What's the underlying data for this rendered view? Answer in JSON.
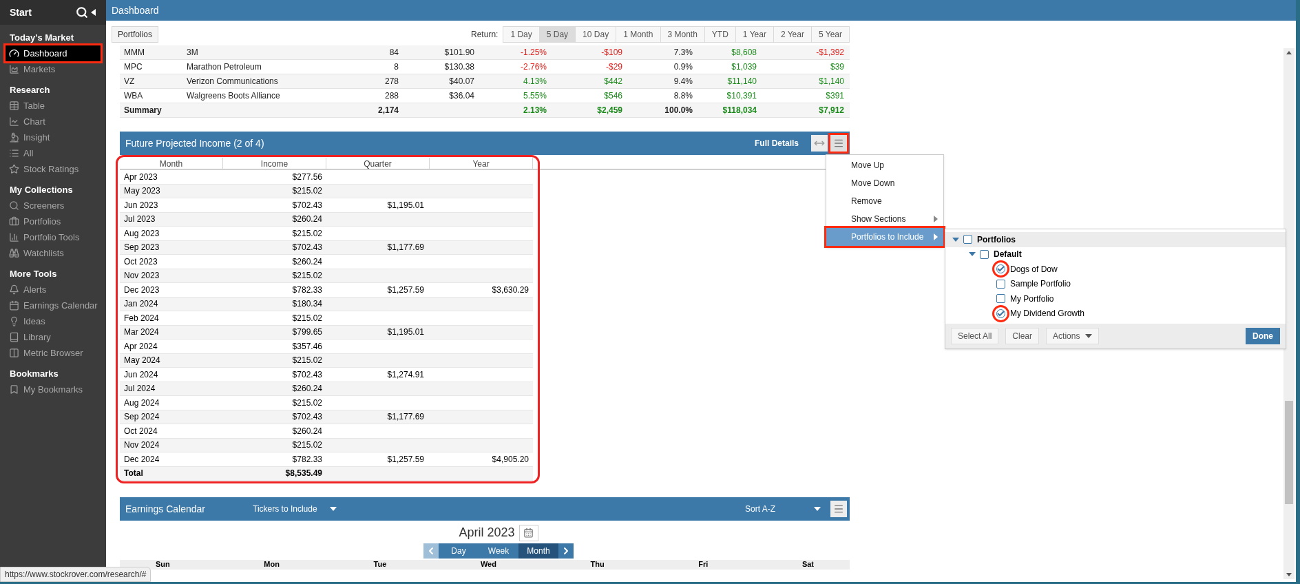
{
  "sidebar": {
    "title": "Start",
    "sections": [
      {
        "heading": "Today's Market",
        "items": [
          {
            "label": "Dashboard",
            "selected": true,
            "highlighted": true
          },
          {
            "label": "Markets",
            "selected": false,
            "highlighted": false
          }
        ]
      },
      {
        "heading": "Research",
        "items": [
          {
            "label": "Table",
            "selected": false,
            "highlighted": false
          },
          {
            "label": "Chart",
            "selected": false,
            "highlighted": false
          },
          {
            "label": "Insight",
            "selected": false,
            "highlighted": false
          },
          {
            "label": "All",
            "selected": false,
            "highlighted": false
          },
          {
            "label": "Stock Ratings",
            "selected": false,
            "highlighted": false
          }
        ]
      },
      {
        "heading": "My Collections",
        "items": [
          {
            "label": "Screeners",
            "selected": false,
            "highlighted": false
          },
          {
            "label": "Portfolios",
            "selected": false,
            "highlighted": false
          },
          {
            "label": "Portfolio Tools",
            "selected": false,
            "highlighted": false
          },
          {
            "label": "Watchlists",
            "selected": false,
            "highlighted": false
          }
        ]
      },
      {
        "heading": "More Tools",
        "items": [
          {
            "label": "Alerts",
            "selected": false,
            "highlighted": false
          },
          {
            "label": "Earnings Calendar",
            "selected": false,
            "highlighted": false
          },
          {
            "label": "Ideas",
            "selected": false,
            "highlighted": false
          },
          {
            "label": "Library",
            "selected": false,
            "highlighted": false
          },
          {
            "label": "Metric Browser",
            "selected": false,
            "highlighted": false
          }
        ]
      },
      {
        "heading": "Bookmarks",
        "items": [
          {
            "label": "My Bookmarks",
            "selected": false,
            "highlighted": false
          }
        ]
      }
    ]
  },
  "page_title": "Dashboard",
  "toolbar": {
    "portfolios_button": "Portfolios",
    "return_label": "Return:",
    "periods": [
      {
        "label": "1 Day",
        "selected": false
      },
      {
        "label": "5 Day",
        "selected": true
      },
      {
        "label": "10 Day",
        "selected": false
      },
      {
        "label": "1 Month",
        "selected": false
      },
      {
        "label": "3 Month",
        "selected": false
      },
      {
        "label": "YTD",
        "selected": false
      },
      {
        "label": "1 Year",
        "selected": false
      },
      {
        "label": "2 Year",
        "selected": false
      },
      {
        "label": "5 Year",
        "selected": false
      }
    ]
  },
  "holdings": {
    "rows": [
      {
        "kind": "stock",
        "cells": [
          {
            "text": "MMM"
          },
          {
            "text": "3M"
          },
          {
            "text": "84"
          },
          {
            "text": "$101.90"
          },
          {
            "text": "-1.25%",
            "color": "#e0201c"
          },
          {
            "text": "-$109",
            "color": "#e0201c"
          },
          {
            "text": "7.3%"
          },
          {
            "text": "$8,608",
            "color": "#1b8a1b"
          },
          {
            "text": "-$1,392",
            "color": "#e0201c"
          }
        ]
      },
      {
        "kind": "stock",
        "cells": [
          {
            "text": "MPC"
          },
          {
            "text": "Marathon Petroleum"
          },
          {
            "text": "8"
          },
          {
            "text": "$130.38"
          },
          {
            "text": "-2.76%",
            "color": "#e0201c"
          },
          {
            "text": "-$29",
            "color": "#e0201c"
          },
          {
            "text": "0.9%"
          },
          {
            "text": "$1,039",
            "color": "#1b8a1b"
          },
          {
            "text": "$39",
            "color": "#1b8a1b"
          }
        ]
      },
      {
        "kind": "stock",
        "cells": [
          {
            "text": "VZ"
          },
          {
            "text": "Verizon Communications"
          },
          {
            "text": "278"
          },
          {
            "text": "$40.07"
          },
          {
            "text": "4.13%",
            "color": "#1b8a1b"
          },
          {
            "text": "$442",
            "color": "#1b8a1b"
          },
          {
            "text": "9.4%"
          },
          {
            "text": "$11,140",
            "color": "#1b8a1b"
          },
          {
            "text": "$1,140",
            "color": "#1b8a1b"
          }
        ]
      },
      {
        "kind": "stock",
        "cells": [
          {
            "text": "WBA"
          },
          {
            "text": "Walgreens Boots Alliance"
          },
          {
            "text": "288"
          },
          {
            "text": "$36.04"
          },
          {
            "text": "5.55%",
            "color": "#1b8a1b"
          },
          {
            "text": "$546",
            "color": "#1b8a1b"
          },
          {
            "text": "8.8%"
          },
          {
            "text": "$10,391",
            "color": "#1b8a1b"
          },
          {
            "text": "$391",
            "color": "#1b8a1b"
          }
        ]
      },
      {
        "kind": "summary",
        "cells": [
          {
            "text": "Summary"
          },
          null,
          {
            "text": "2,174"
          },
          null,
          {
            "text": "2.13%",
            "color": "#1b8a1b"
          },
          {
            "text": "$2,459",
            "color": "#1b8a1b"
          },
          {
            "text": "100.0%"
          },
          {
            "text": "$118,034",
            "color": "#1b8a1b"
          },
          {
            "text": "$7,912",
            "color": "#1b8a1b"
          }
        ]
      }
    ]
  },
  "income": {
    "title": "Future Projected Income (2 of 4)",
    "full_details": "Full Details",
    "menu_highlighted": true,
    "table_highlighted": true,
    "columns": [
      "Month",
      "Income",
      "Quarter",
      "Year"
    ],
    "rows": [
      {
        "kind": "month",
        "cells": [
          "Apr 2023",
          "$277.56",
          null,
          null
        ]
      },
      {
        "kind": "month",
        "cells": [
          "May 2023",
          "$215.02",
          null,
          null
        ]
      },
      {
        "kind": "month",
        "cells": [
          "Jun 2023",
          "$702.43",
          "$1,195.01",
          null
        ]
      },
      {
        "kind": "month",
        "cells": [
          "Jul 2023",
          "$260.24",
          null,
          null
        ]
      },
      {
        "kind": "month",
        "cells": [
          "Aug 2023",
          "$215.02",
          null,
          null
        ]
      },
      {
        "kind": "month",
        "cells": [
          "Sep 2023",
          "$702.43",
          "$1,177.69",
          null
        ]
      },
      {
        "kind": "month",
        "cells": [
          "Oct 2023",
          "$260.24",
          null,
          null
        ]
      },
      {
        "kind": "month",
        "cells": [
          "Nov 2023",
          "$215.02",
          null,
          null
        ]
      },
      {
        "kind": "month",
        "cells": [
          "Dec 2023",
          "$782.33",
          "$1,257.59",
          "$3,630.29"
        ]
      },
      {
        "kind": "month",
        "cells": [
          "Jan 2024",
          "$180.34",
          null,
          null
        ]
      },
      {
        "kind": "month",
        "cells": [
          "Feb 2024",
          "$215.02",
          null,
          null
        ]
      },
      {
        "kind": "month",
        "cells": [
          "Mar 2024",
          "$799.65",
          "$1,195.01",
          null
        ]
      },
      {
        "kind": "month",
        "cells": [
          "Apr 2024",
          "$357.46",
          null,
          null
        ]
      },
      {
        "kind": "month",
        "cells": [
          "May 2024",
          "$215.02",
          null,
          null
        ]
      },
      {
        "kind": "month",
        "cells": [
          "Jun 2024",
          "$702.43",
          "$1,274.91",
          null
        ]
      },
      {
        "kind": "month",
        "cells": [
          "Jul 2024",
          "$260.24",
          null,
          null
        ]
      },
      {
        "kind": "month",
        "cells": [
          "Aug 2024",
          "$215.02",
          null,
          null
        ]
      },
      {
        "kind": "month",
        "cells": [
          "Sep 2024",
          "$702.43",
          "$1,177.69",
          null
        ]
      },
      {
        "kind": "month",
        "cells": [
          "Oct 2024",
          "$260.24",
          null,
          null
        ]
      },
      {
        "kind": "month",
        "cells": [
          "Nov 2024",
          "$215.02",
          null,
          null
        ]
      },
      {
        "kind": "month",
        "cells": [
          "Dec 2024",
          "$782.33",
          "$1,257.59",
          "$4,905.20"
        ]
      },
      {
        "kind": "total",
        "cells": [
          "Total",
          "$8,535.49",
          null,
          null
        ]
      }
    ]
  },
  "context_menu": {
    "items": [
      {
        "label": "Move Up",
        "selected": false,
        "submenu": false,
        "highlighted": false
      },
      {
        "label": "Move Down",
        "selected": false,
        "submenu": false,
        "highlighted": false
      },
      {
        "label": "Remove",
        "selected": false,
        "submenu": false,
        "highlighted": false
      },
      {
        "label": "Show Sections",
        "selected": false,
        "submenu": true,
        "highlighted": false
      },
      {
        "label": "Portfolios to Include",
        "selected": true,
        "submenu": true,
        "highlighted": true
      }
    ]
  },
  "portfolio_picker": {
    "tree": [
      {
        "label": "Portfolios",
        "checked": false,
        "expanded": true,
        "highlighted": false,
        "children": [
          {
            "label": "Default",
            "checked": false,
            "expanded": true,
            "highlighted": false,
            "children": [
              {
                "label": "Dogs of Dow",
                "checked": true,
                "highlighted": true
              },
              {
                "label": "Sample Portfolio",
                "checked": false,
                "highlighted": false
              },
              {
                "label": "My Portfolio",
                "checked": false,
                "highlighted": false
              },
              {
                "label": "My Dividend Growth",
                "checked": true,
                "highlighted": true
              }
            ]
          }
        ]
      }
    ],
    "buttons": [
      "Select All",
      "Clear"
    ],
    "actions": "Actions",
    "done": "Done"
  },
  "earnings": {
    "title": "Earnings Calendar",
    "tickers": "Tickers to Include",
    "sort": "Sort A-Z",
    "month": "April 2023",
    "views": [
      {
        "label": "Day",
        "selected": false
      },
      {
        "label": "Week",
        "selected": false
      },
      {
        "label": "Month",
        "selected": true
      }
    ],
    "weekdays": [
      "Sun",
      "Mon",
      "Tue",
      "Wed",
      "Thu",
      "Fri",
      "Sat"
    ]
  },
  "status_url": "https://www.stockrover.com/research/#"
}
